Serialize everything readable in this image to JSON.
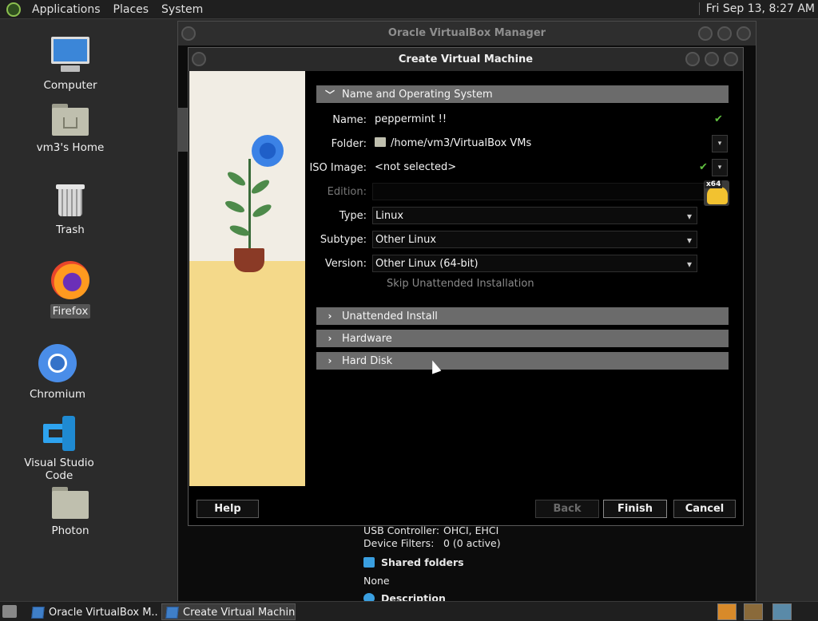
{
  "top_panel": {
    "menus": [
      "Applications",
      "Places",
      "System"
    ],
    "clock": "Fri Sep 13,  8:27 AM"
  },
  "desktop": {
    "icons": [
      {
        "label": "Computer",
        "icon": "computer-icon"
      },
      {
        "label": "vm3's Home",
        "icon": "home-folder-icon"
      },
      {
        "label": "Trash",
        "icon": "trash-icon"
      },
      {
        "label": "Firefox",
        "icon": "firefox-icon"
      },
      {
        "label": "Chromium",
        "icon": "chromium-icon"
      },
      {
        "label": "Visual Studio Code",
        "icon": "vscode-icon"
      },
      {
        "label": "Photon",
        "icon": "folder-icon"
      }
    ]
  },
  "vbox_manager": {
    "title": "Oracle VirtualBox Manager",
    "details": {
      "usb_controller_key": "USB Controller:",
      "usb_controller_val": "OHCI, EHCI",
      "device_filters_key": "Device Filters:",
      "device_filters_val": "0 (0 active)",
      "shared_folders": "Shared folders",
      "shared_folders_val": "None",
      "description": "Description"
    }
  },
  "dialog": {
    "title": "Create Virtual Machine",
    "sections": {
      "name_os": "Name and Operating System",
      "unattended": "Unattended Install",
      "hardware": "Hardware",
      "hard_disk": "Hard Disk"
    },
    "fields": {
      "name_label": "Name:",
      "name_value": "peppermint !!",
      "folder_label": "Folder:",
      "folder_value": "/home/vm3/VirtualBox VMs",
      "iso_label": "ISO Image:",
      "iso_value": "<not selected>",
      "edition_label": "Edition:",
      "edition_value": "",
      "type_label": "Type:",
      "type_value": "Linux",
      "subtype_label": "Subtype:",
      "subtype_value": "Other Linux",
      "version_label": "Version:",
      "version_value": "Other Linux (64-bit)"
    },
    "os_badge": "x64",
    "skip_unattended": "Skip Unattended Installation",
    "buttons": {
      "help": "Help",
      "back": "Back",
      "finish": "Finish",
      "cancel": "Cancel"
    }
  },
  "taskbar": {
    "items": [
      "Oracle VirtualBox M...",
      "Create Virtual Machine"
    ]
  },
  "colors": {
    "section_header": "#6b6b6b",
    "check_green": "#5fbf3f",
    "illustration_table": "#f4d98a"
  }
}
